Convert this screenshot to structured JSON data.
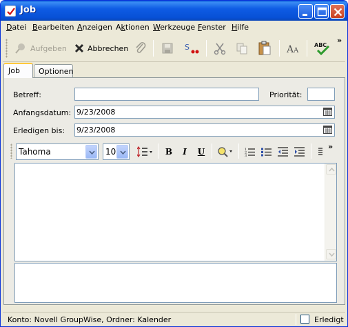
{
  "window": {
    "title": "Job",
    "accent": "#0a5bd8"
  },
  "menubar": {
    "items": [
      {
        "label": "Datei",
        "mnemonic": "D"
      },
      {
        "label": "Bearbeiten",
        "mnemonic": "B"
      },
      {
        "label": "Anzeigen",
        "mnemonic": "A"
      },
      {
        "label": "Aktionen",
        "mnemonic": "k"
      },
      {
        "label": "Werkzeuge",
        "mnemonic": "W"
      },
      {
        "label": "Fenster",
        "mnemonic": "F"
      },
      {
        "label": "Hilfe",
        "mnemonic": "H"
      }
    ]
  },
  "toolbar": {
    "aufgeben_label": "Aufgeben",
    "abbrechen_label": "Abbrechen",
    "overflow": "»"
  },
  "tabs": [
    {
      "label": "Job",
      "active": true
    },
    {
      "label": "Optionen",
      "active": false
    }
  ],
  "form": {
    "betreff_label": "Betreff:",
    "betreff_value": "",
    "prioritaet_label": "Priorität:",
    "prioritaet_value": "",
    "anfangsdatum_label": "Anfangsdatum:",
    "anfangsdatum_value": "9/23/2008",
    "erledigen_label": "Erledigen bis:",
    "erledigen_value": "9/23/2008"
  },
  "format": {
    "font": "Tahoma",
    "size": "10",
    "bold": "B",
    "italic": "I",
    "underline": "U",
    "overflow": "»"
  },
  "status": {
    "text": "Konto: Novell GroupWise,  Ordner: Kalender",
    "erledigt_label": "Erledigt",
    "erledigt_checked": false
  }
}
